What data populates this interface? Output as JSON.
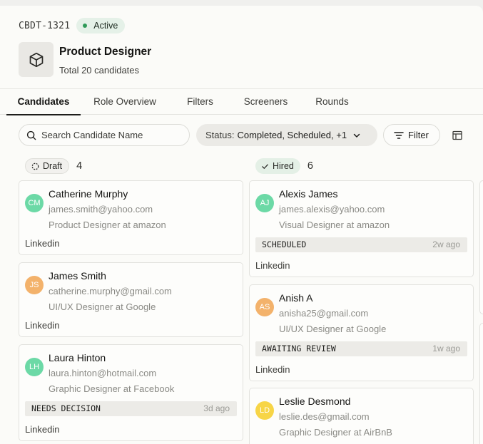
{
  "header": {
    "req_id": "CBDT-1321",
    "status": "Active",
    "role_title": "Product Designer",
    "role_subtitle": "Total 20 candidates",
    "role_icon": "box-icon"
  },
  "tabs": [
    {
      "label": "Candidates",
      "active": true
    },
    {
      "label": "Role Overview",
      "active": false
    },
    {
      "label": "Filters",
      "active": false
    },
    {
      "label": "Screeners",
      "active": false
    },
    {
      "label": "Rounds",
      "active": false
    }
  ],
  "toolbar": {
    "search_placeholder": "Search Candidate Name",
    "status_label": "Status:",
    "status_value": "Completed, Scheduled, +1",
    "filter_label": "Filter"
  },
  "columns": [
    {
      "stage": "Draft",
      "count": "4",
      "cards": [
        {
          "initials": "CM",
          "name": "Catherine Murphy",
          "email": "james.smith@yahoo.com",
          "role": "Product Designer at amazon",
          "source": "Linkedin",
          "avatar_color": "#6cd9a6"
        },
        {
          "initials": "JS",
          "name": "James Smith",
          "email": "catherine.murphy@gmail.com",
          "role": "UI/UX Designer at Google",
          "source": "Linkedin",
          "avatar_color": "#f3b26b"
        },
        {
          "initials": "LH",
          "name": "Laura Hinton",
          "email": "laura.hinton@hotmail.com",
          "role": "Graphic Designer at Facebook",
          "tag": "NEEDS DECISION",
          "ago": "3d ago",
          "source": "Linkedin",
          "avatar_color": "#6cd9a6"
        }
      ]
    },
    {
      "stage": "Hired",
      "count": "6",
      "cards": [
        {
          "initials": "AJ",
          "name": "Alexis James",
          "email": "james.alexis@yahoo.com",
          "role": "Visual Designer at amazon",
          "tag": "SCHEDULED",
          "ago": "2w ago",
          "source": "Linkedin",
          "avatar_color": "#6cd9a6"
        },
        {
          "initials": "AS",
          "name": "Anish A",
          "email": "anisha25@gmail.com",
          "role": "UI/UX Designer at Google",
          "tag": "AWAITING REVIEW",
          "ago": "1w ago",
          "source": "Linkedin",
          "avatar_color": "#f3b26b"
        },
        {
          "initials": "LD",
          "name": "Leslie Desmond",
          "email": "leslie.des@gmail.com",
          "role": "Graphic Designer at AirBnB",
          "avatar_color": "#f7d547"
        }
      ]
    }
  ],
  "colors": {
    "active_green": "#2f9a58",
    "background": "#fbfbf8",
    "tag_bg": "#ecebe7"
  }
}
